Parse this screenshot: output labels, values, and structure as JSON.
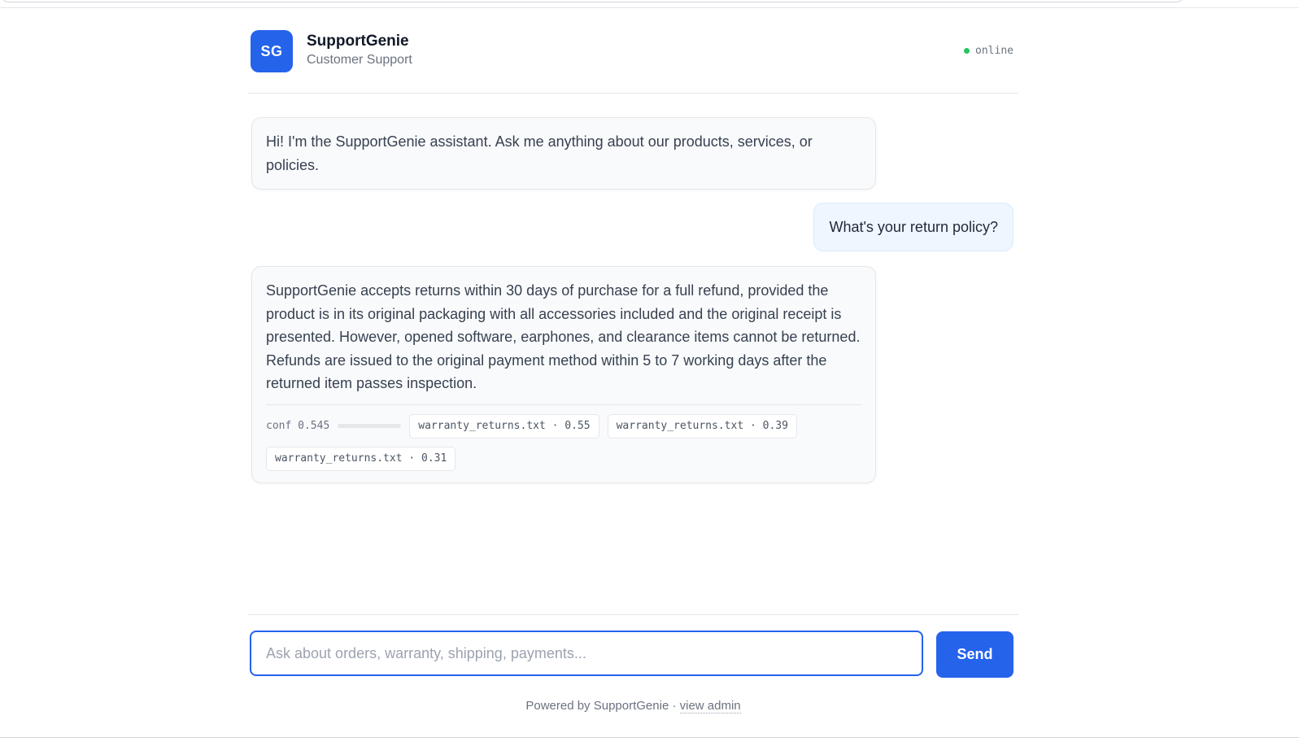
{
  "header": {
    "avatar_initials": "SG",
    "brand_name": "SupportGenie",
    "brand_subtitle": "Customer Support",
    "status_text": "online",
    "status_color": "#22c55e"
  },
  "messages": [
    {
      "role": "assistant",
      "text": "Hi! I'm the SupportGenie assistant. Ask me anything about our products, services, or policies."
    },
    {
      "role": "user",
      "text": "What's your return policy?"
    },
    {
      "role": "assistant",
      "text": "SupportGenie accepts returns within 30 days of purchase for a full refund, provided the product is in its original packaging with all accessories included and the original receipt is presented. However, opened software, earphones, and clearance items cannot be returned. Refunds are issued to the original payment method within 5 to 7 working days after the returned item passes inspection.",
      "confidence_label": "conf 0.545",
      "confidence": 0.545,
      "sources": [
        "warranty_returns.txt · 0.55",
        "warranty_returns.txt · 0.39",
        "warranty_returns.txt · 0.31"
      ]
    }
  ],
  "composer": {
    "placeholder": "Ask about orders, warranty, shipping, payments...",
    "send_label": "Send"
  },
  "footer": {
    "powered_text": "Powered by SupportGenie · ",
    "admin_link": "view admin"
  },
  "colors": {
    "accent": "#2563eb",
    "user_bubble": "#eff6ff",
    "bot_bubble": "#f9fafb"
  }
}
